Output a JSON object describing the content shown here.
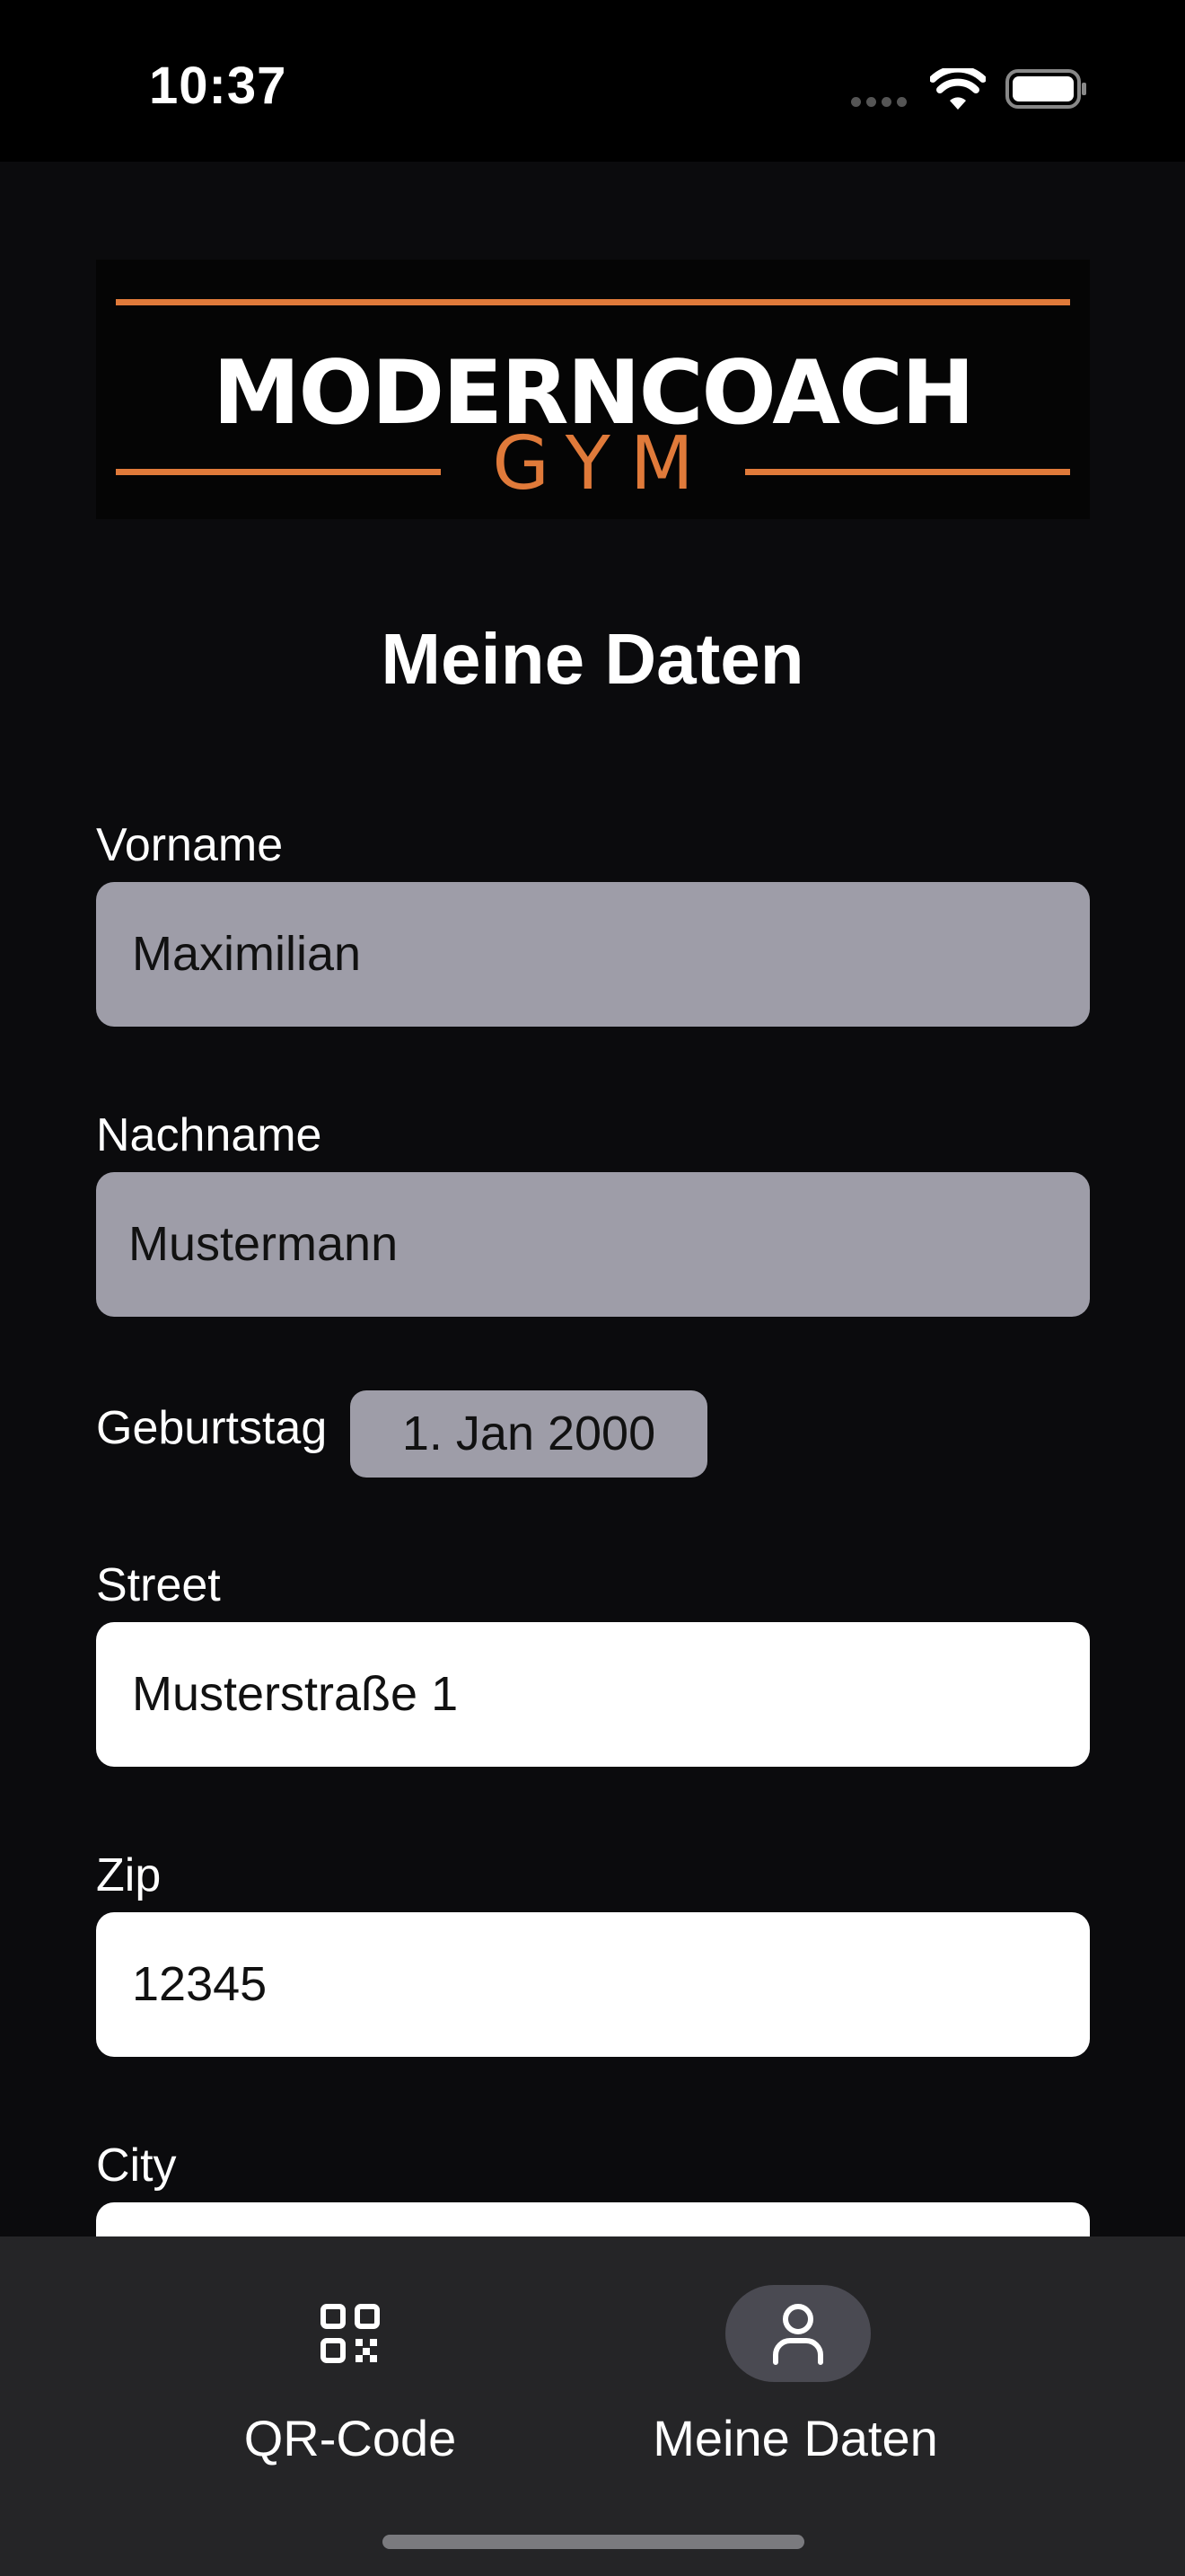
{
  "status_bar": {
    "time": "10:37"
  },
  "logo": {
    "brand": "MODERNCOACH",
    "sub": "GYM"
  },
  "page": {
    "title": "Meine Daten"
  },
  "form": {
    "first_name": {
      "label": "Vorname",
      "value": "Maximilian"
    },
    "last_name": {
      "label": "Nachname",
      "value": "Mustermann"
    },
    "birthday": {
      "label": "Geburtstag",
      "value": "1. Jan 2000"
    },
    "street": {
      "label": "Street",
      "value": "Musterstraße 1"
    },
    "zip": {
      "label": "Zip",
      "value": "12345"
    },
    "city": {
      "label": "City",
      "value": ""
    }
  },
  "tab_bar": {
    "tabs": [
      {
        "label": "QR-Code",
        "icon": "qr-code-icon",
        "active": false
      },
      {
        "label": "Meine Daten",
        "icon": "person-icon",
        "active": true
      }
    ]
  },
  "colors": {
    "accent": "#e07a3a",
    "disabled_field": "#9e9da8",
    "background": "#0b0b0d",
    "tab_bar": "#252527"
  }
}
